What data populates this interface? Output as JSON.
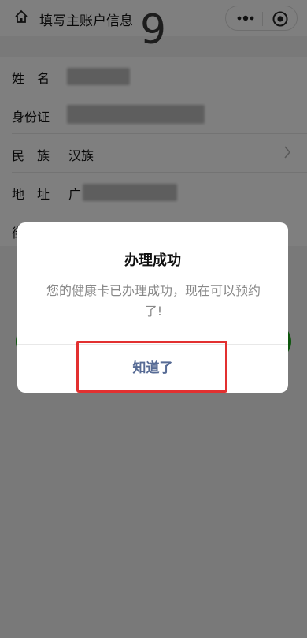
{
  "header": {
    "title": "填写主账户信息",
    "overlay_digit": "9",
    "home_icon": "home-icon",
    "more_icon": "more-dots-icon",
    "close_icon": "mini-program-close-icon"
  },
  "form": {
    "rows": [
      {
        "label": "姓　名",
        "value": ""
      },
      {
        "label": "身份证",
        "value": ""
      },
      {
        "label": "民　族",
        "value": "汉族"
      },
      {
        "label": "地　址",
        "value": "广"
      },
      {
        "label": "街",
        "value": ""
      }
    ]
  },
  "dialog": {
    "title": "办理成功",
    "message": "您的健康卡已办理成功，现在可以预约了!",
    "confirm_label": "知道了"
  },
  "colors": {
    "confirm": "#576b95",
    "highlight": "#e23030",
    "primary_green": "#1aad19"
  }
}
